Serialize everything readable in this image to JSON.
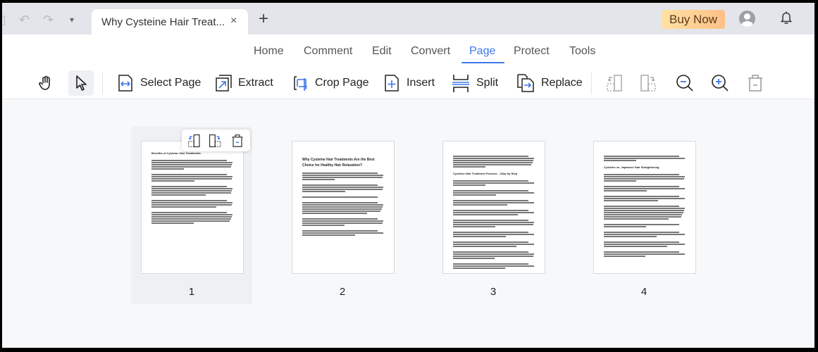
{
  "titlebar": {
    "tab_title": "Why Cysteine Hair Treat...",
    "tab_close_icon": "×",
    "new_tab_icon": "+",
    "buy_now": "Buy Now",
    "more_icon": "⋮",
    "quick_access": {
      "undo_icon": "↶",
      "redo_icon": "↷",
      "dropdown_icon": "▾"
    }
  },
  "menu": {
    "items": [
      "Home",
      "Comment",
      "Edit",
      "Convert",
      "Page",
      "Protect",
      "Tools"
    ],
    "active": "Page"
  },
  "toolbar": {
    "select_page": "Select Page",
    "extract": "Extract",
    "crop_page": "Crop Page",
    "insert": "Insert",
    "split": "Split",
    "replace": "Replace"
  },
  "colors": {
    "accent": "#3f76e8",
    "buy_now_start": "#ffe1a3",
    "buy_now_end": "#ffc088",
    "canvas_bg": "#f7f8fa"
  },
  "pages": [
    {
      "number": "1",
      "heading": "Benefits of Cysteine Hair Treatments",
      "selected": true
    },
    {
      "number": "2",
      "heading": "Why Cysteine Hair Treatments Are the Best Choice for Healthy Hair Relaxation?",
      "selected": false
    },
    {
      "number": "3",
      "heading": "Cysteine Hair Treatment Process – Step by Step",
      "selected": false
    },
    {
      "number": "4",
      "heading": "Cysteine vs. Japanese Hair Straightening",
      "selected": false
    }
  ]
}
